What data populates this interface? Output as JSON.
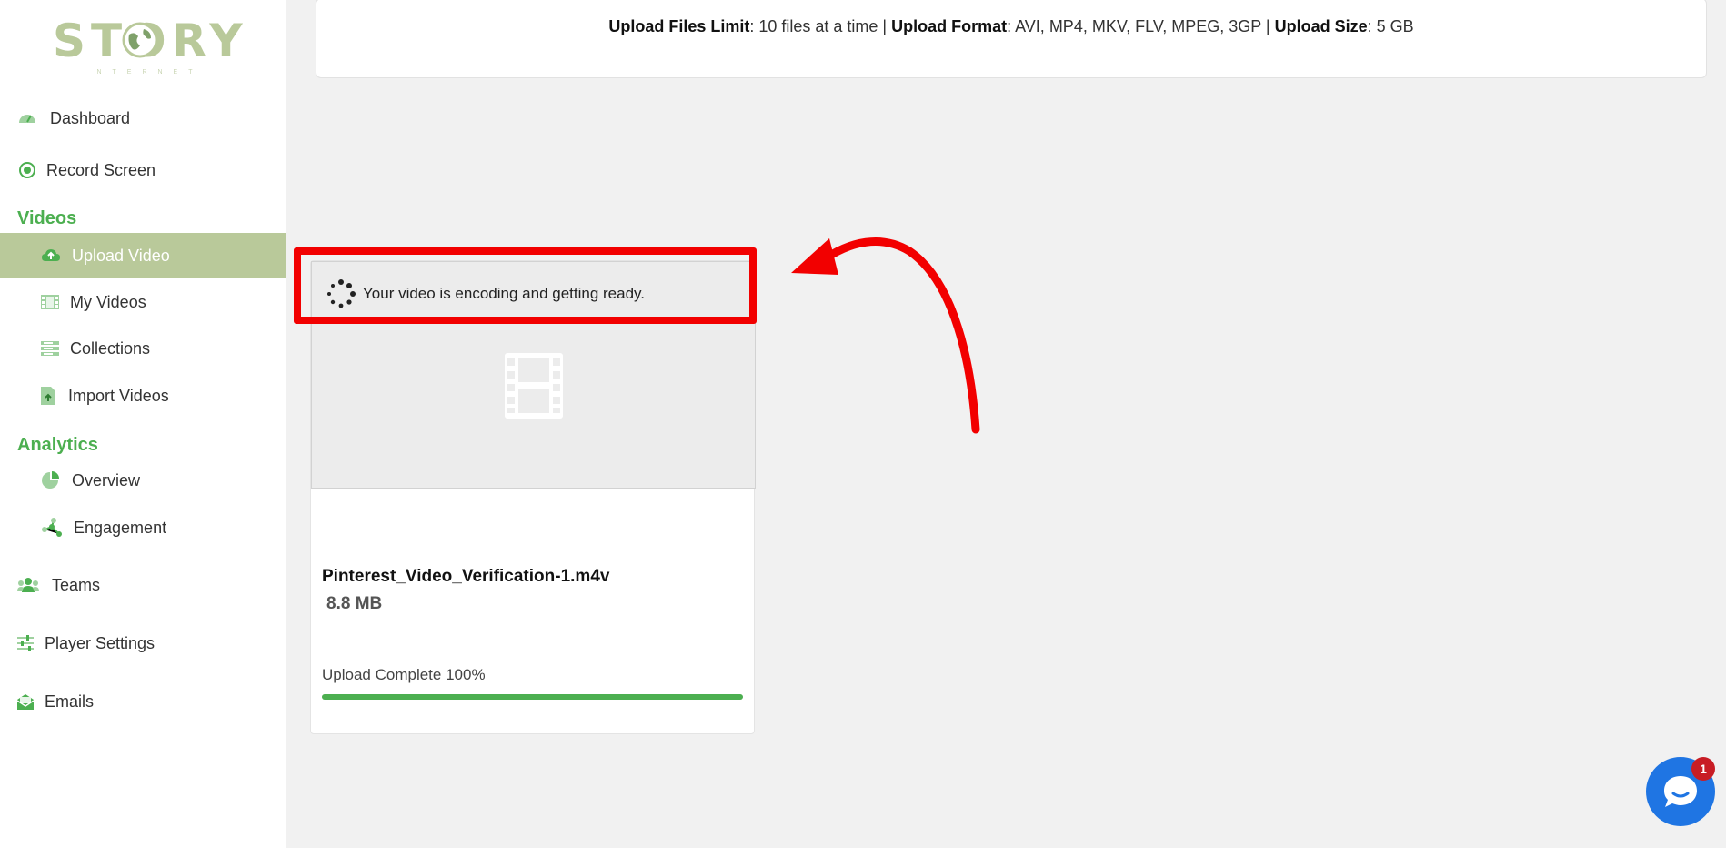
{
  "logo": {
    "text": "STORY",
    "subtext": "INTERNET"
  },
  "sidebar": {
    "items": [
      {
        "label": "Dashboard",
        "icon": "dashboard-gauge-icon"
      },
      {
        "label": "Record Screen",
        "icon": "record-icon"
      }
    ],
    "videos_section": "Videos",
    "video_items": [
      {
        "label": "Upload Video",
        "icon": "cloud-upload-icon",
        "active": true
      },
      {
        "label": "My Videos",
        "icon": "film-strip-icon"
      },
      {
        "label": "Collections",
        "icon": "list-icon"
      },
      {
        "label": "Import Videos",
        "icon": "file-import-icon"
      }
    ],
    "analytics_section": "Analytics",
    "analytics_items": [
      {
        "label": "Overview",
        "icon": "pie-chart-icon"
      },
      {
        "label": "Engagement",
        "icon": "nodes-icon"
      }
    ],
    "bottom_items": [
      {
        "label": "Teams",
        "icon": "users-icon"
      },
      {
        "label": "Player Settings",
        "icon": "sliders-icon"
      },
      {
        "label": "Emails",
        "icon": "envelope-icon"
      }
    ]
  },
  "upload_info": {
    "files_limit_label": "Upload Files Limit",
    "files_limit_value": ": 10 files at a time | ",
    "format_label": "Upload Format",
    "format_value": ": AVI, MP4, MKV, FLV, MPEG, 3GP | ",
    "size_label": "Upload Size",
    "size_value": ": 5 GB"
  },
  "video_card": {
    "encoding_message": "Your video is encoding and getting ready.",
    "file_name": "Pinterest_Video_Verification-1.m4v",
    "file_size": "8.8 MB",
    "status": "Upload Complete 100%",
    "progress_fraction": 1.0
  },
  "chat": {
    "badge_count": "1"
  },
  "colors": {
    "accent_green": "#4caf50",
    "active_bg": "#b9c99a",
    "annotation_red": "#f20000",
    "chat_blue": "#1f75e3"
  }
}
